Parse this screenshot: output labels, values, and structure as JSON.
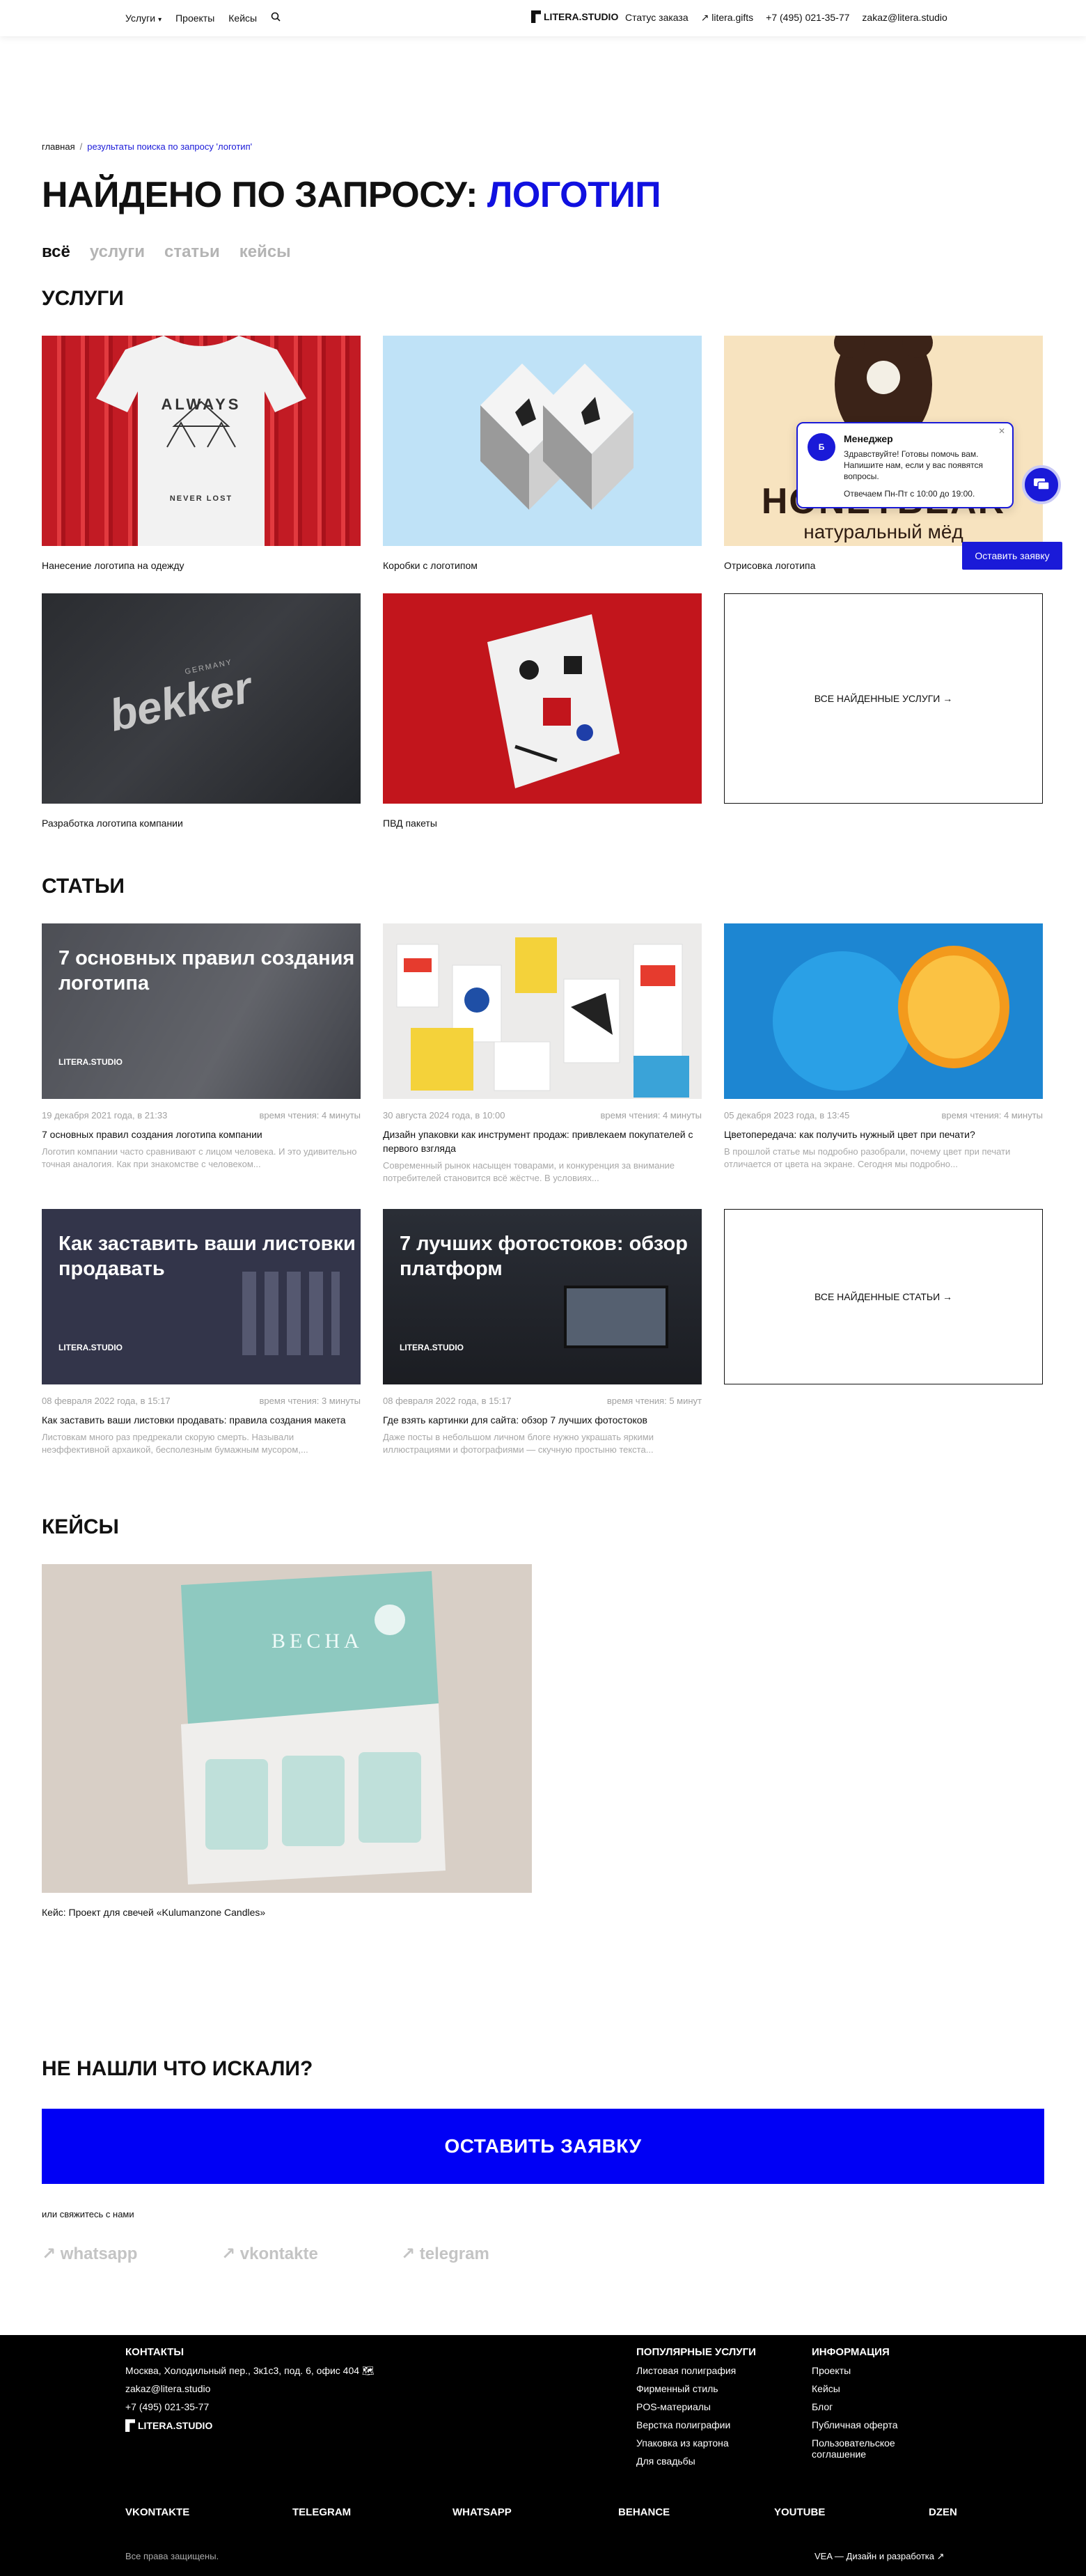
{
  "header": {
    "nav_left": [
      "Услуги",
      "Проекты",
      "Кейсы"
    ],
    "logo": "LITERA.STUDIO",
    "nav_right": [
      "Статус заказа",
      "↗ litera.gifts",
      "+7 (495) 021-35-77",
      "zakaz@litera.studio"
    ]
  },
  "breadcrumb": {
    "home": "главная",
    "sep": "/",
    "current": "результаты поиска по запросу 'логотип'"
  },
  "title": {
    "prefix": "НАЙДЕНО ПО ЗАПРОСУ:",
    "query": "ЛОГОТИП"
  },
  "tabs": [
    "всё",
    "услуги",
    "статьи",
    "кейсы"
  ],
  "services": {
    "heading": "УСЛУГИ",
    "items": [
      "Нанесение логотипа на одежду",
      "Коробки с логотипом",
      "Отрисовка логотипа",
      "Разработка логотипа компании",
      "ПВД пакеты"
    ],
    "all_label": "ВСЕ НАЙДЕННЫЕ УСЛУГИ →",
    "img_text": {
      "shirt": "ALWAYS",
      "shirt2": "NEVER LOST",
      "honey1": "HONEYBEAR",
      "honey2": "натуральный мёд",
      "bekker": "bekker",
      "bekker_sub": "GERMANY"
    }
  },
  "articles": {
    "heading": "СТАТЬИ",
    "items": [
      {
        "date": "19 декабря 2021 года, в 21:33",
        "read": "время чтения: 4 минуты",
        "title": "7 основных правил создания логотипа компании",
        "excerpt": "Логотип компании часто сравнивают с лицом человека. И это удивительно точная аналогия. Как при знакомстве с человеком...",
        "overlay": "7 основных правил создания логотипа",
        "logo": "LITERA.STUDIO"
      },
      {
        "date": "30 августа 2024 года, в 10:00",
        "read": "время чтения: 4 минуты",
        "title": "Дизайн упаковки как инструмент продаж: привлекаем покупателей с первого взгляда",
        "excerpt": "Современный рынок насыщен товарами, и конкуренция за внимание потребителей становится всё жёстче. В условиях...",
        "overlay": "",
        "logo": ""
      },
      {
        "date": "05 декабря 2023 года, в 13:45",
        "read": "время чтения: 4 минуты",
        "title": "Цветопередача: как получить нужный цвет при печати?",
        "excerpt": "В прошлой статье мы подробно разобрали, почему цвет при печати отличается от цвета на экране. Сегодня мы подробно...",
        "overlay": "",
        "logo": ""
      },
      {
        "date": "08 февраля 2022 года, в 15:17",
        "read": "время чтения: 3 минуты",
        "title": "Как заставить ваши листовки продавать: правила создания макета",
        "excerpt": "Листовкам много раз предрекали скорую смерть. Называли неэффективной архаикой, бесполезным бумажным мусором,...",
        "overlay": "Как заставить ваши листовки продавать",
        "logo": "LITERA.STUDIO"
      },
      {
        "date": "08 февраля 2022 года, в 15:17",
        "read": "время чтения: 5 минут",
        "title": "Где взять картинки для сайта: обзор 7 лучших фотостоков",
        "excerpt": "Даже посты в небольшом личном блоге нужно украшать яркими иллюстрациями и фотографиями — скучную простыню текста...",
        "overlay": "7 лучших фотостоков: обзор платформ",
        "logo": "LITERA.STUDIO"
      }
    ],
    "all_label": "ВСЕ НАЙДЕННЫЕ СТАТЬИ →"
  },
  "cases": {
    "heading": "КЕЙСЫ",
    "items": [
      {
        "title": "Кейс: Проект для свечей «Kulumanzone Candles»",
        "img_text": "ВЕСНА"
      }
    ]
  },
  "chat": {
    "name": "Менеджер",
    "message": "Здравствуйте! Готовы помочь вам. Напишите нам, если у вас появятся вопросы.",
    "hours": "Отвечаем Пн-Пт с 10:00 до 19:00.",
    "button": "Оставить заявку"
  },
  "cta": {
    "heading": "НЕ НАШЛИ ЧТО ИСКАЛИ?",
    "button": "ОСТАВИТЬ ЗАЯВКУ",
    "or": "или свяжитесь с нами",
    "links": [
      "↗ whatsapp",
      "↗ vkontakte",
      "↗ telegram"
    ]
  },
  "footer": {
    "contacts_h": "КОНТАКТЫ",
    "address": "Москва, Холодильный пер., 3к1с3, под. 6, офис 404",
    "email": "zakaz@litera.studio",
    "phone": "+7 (495) 021-35-77",
    "logo": "LITERA.STUDIO",
    "popular_h": "ПОПУЛЯРНЫЕ УСЛУГИ",
    "popular": [
      "Листовая полиграфия",
      "Фирменный стиль",
      "POS-материалы",
      "Верстка полиграфии",
      "Упаковка из картона",
      "Для свадьбы"
    ],
    "info_h": "ИНФОРМАЦИЯ",
    "info": [
      "Проекты",
      "Кейсы",
      "Блог",
      "Публичная оферта",
      "Пользовательское соглашение"
    ],
    "socials": [
      "VKONTAKTE",
      "TELEGRAM",
      "WHATSAPP",
      "BEHANCE",
      "YOUTUBE",
      "DZEN"
    ],
    "rights": "Все права защищены.",
    "dev": "VEA — Дизайн и разработка ↗"
  }
}
